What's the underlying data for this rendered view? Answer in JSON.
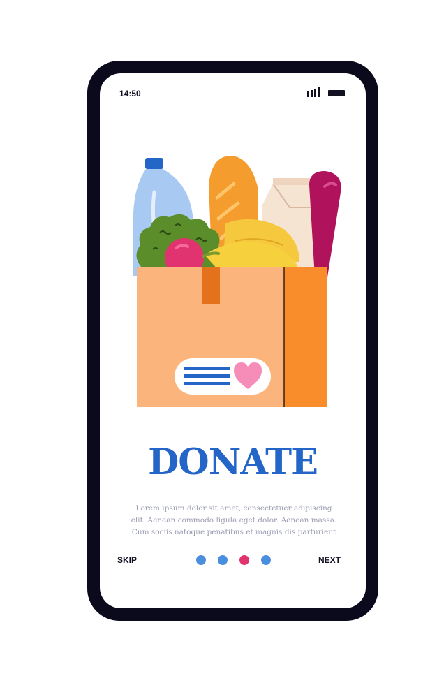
{
  "status_bar": {
    "time": "14:50",
    "signal_icon": "signal-bars-icon",
    "battery_icon": "battery-icon"
  },
  "illustration": {
    "name": "food-donation-box",
    "label_icon": "heart-icon"
  },
  "onboarding": {
    "title": "DONATE",
    "body_lines": [
      "Lorem ipsum dolor sit amet, consectetuer adipiscing",
      "elit. Aenean commodo ligula eget dolor. Aenean massa.",
      "Cum sociis natoque penatibus et magnis dis parturient"
    ]
  },
  "navigation": {
    "skip_label": "SKIP",
    "next_label": "NEXT",
    "page_count": 4,
    "active_page": 3
  },
  "colors": {
    "accent": "#2466c8",
    "dot_inactive": "#4a8ee0",
    "dot_active": "#e0336f",
    "phone_frame": "#0a0a1c"
  }
}
